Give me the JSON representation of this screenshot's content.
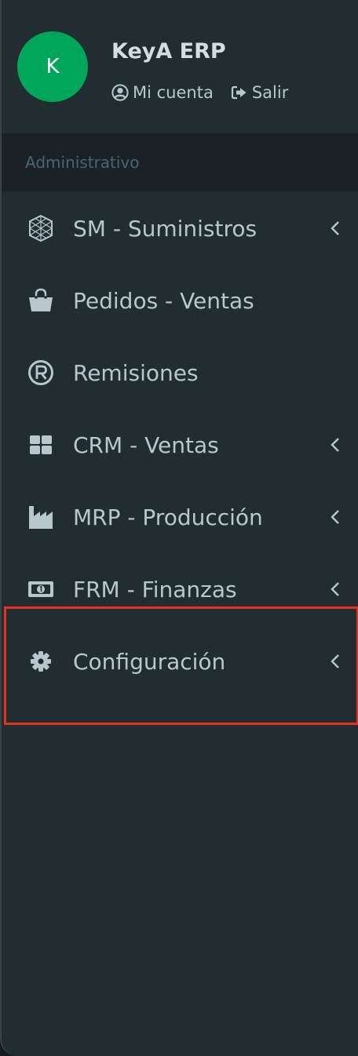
{
  "user": {
    "avatar_initial": "K",
    "app_name": "KeyA ERP",
    "account_label": "Mi cuenta",
    "logout_label": "Salir"
  },
  "menu_header": "Administrativo",
  "menu": {
    "items": [
      {
        "label": "SM - Suministros",
        "icon": "cube-icon",
        "has_submenu": true
      },
      {
        "label": "Pedidos - Ventas",
        "icon": "shopping-bag-icon",
        "has_submenu": false
      },
      {
        "label": "Remisiones",
        "icon": "registered-icon",
        "has_submenu": false
      },
      {
        "label": "CRM - Ventas",
        "icon": "grid-icon",
        "has_submenu": true
      },
      {
        "label": "MRP - Producción",
        "icon": "industry-icon",
        "has_submenu": true
      },
      {
        "label": "FRM - Finanzas",
        "icon": "money-bill-icon",
        "has_submenu": true
      },
      {
        "label": "Configuración",
        "icon": "gear-icon",
        "has_submenu": true
      }
    ]
  },
  "colors": {
    "sidebar_bg": "#222d32",
    "header_bg": "#1a2226",
    "avatar_bg": "#00a65a",
    "text": "#b8c7ce",
    "highlight_border": "#e8321f"
  }
}
